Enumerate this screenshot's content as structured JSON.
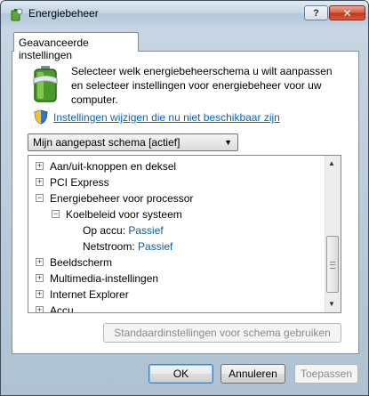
{
  "window": {
    "title": "Energiebeheer",
    "help_label": "?",
    "close_label": "✕"
  },
  "tab": {
    "label": "Geavanceerde instellingen"
  },
  "description": "Selecteer welk energiebeheerschema u wilt aanpassen en selecteer instellingen voor energiebeheer voor uw computer.",
  "link": {
    "label": "Instellingen wijzigen die nu niet beschikbaar zijn"
  },
  "scheme_select": {
    "value": "Mijn aangepast schema [actief]"
  },
  "tree": {
    "items": [
      {
        "label": "Aan/uit-knoppen en deksel",
        "expander": "+"
      },
      {
        "label": "PCI Express",
        "expander": "+"
      },
      {
        "label": "Energiebeheer voor processor",
        "expander": "−"
      },
      {
        "label": "Koelbeleid voor systeem",
        "expander": "−"
      },
      {
        "label": "Op accu:",
        "value": "Passief"
      },
      {
        "label": "Netstroom:",
        "value": "Passief"
      },
      {
        "label": "Beeldscherm",
        "expander": "+"
      },
      {
        "label": "Multimedia-instellingen",
        "expander": "+"
      },
      {
        "label": "Internet Explorer",
        "expander": "+"
      },
      {
        "label": "Accu",
        "expander": "+"
      }
    ]
  },
  "restore_defaults_label": "Standaardinstellingen voor schema gebruiken",
  "buttons": {
    "ok": "OK",
    "cancel": "Annuleren",
    "apply": "Toepassen"
  },
  "colors": {
    "link": "#0066cc",
    "value": "#0060b6",
    "close_button": "#c3381e"
  }
}
